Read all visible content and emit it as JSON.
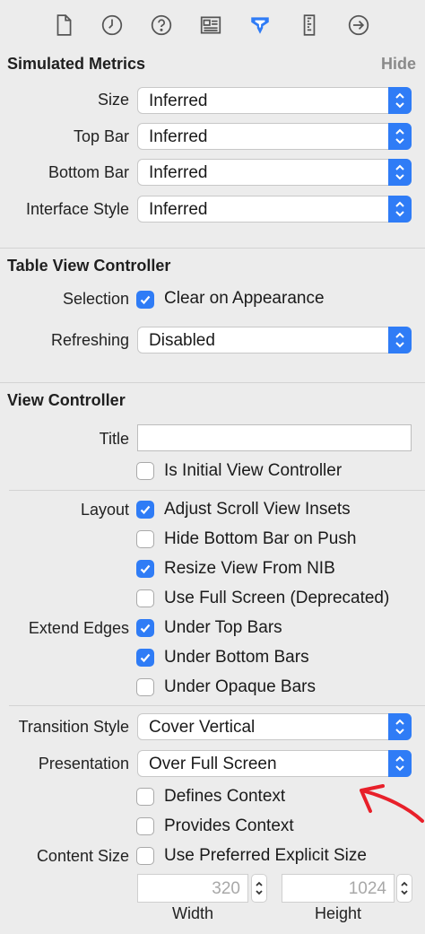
{
  "simulated_metrics": {
    "title": "Simulated Metrics",
    "hide_label": "Hide",
    "rows": [
      {
        "label": "Size",
        "value": "Inferred"
      },
      {
        "label": "Top Bar",
        "value": "Inferred"
      },
      {
        "label": "Bottom Bar",
        "value": "Inferred"
      },
      {
        "label": "Interface Style",
        "value": "Inferred"
      }
    ]
  },
  "table_view_controller": {
    "title": "Table View Controller",
    "selection_label": "Selection",
    "clear_on_appearance": {
      "label": "Clear on Appearance",
      "checked": true
    },
    "refreshing_label": "Refreshing",
    "refreshing_value": "Disabled"
  },
  "view_controller": {
    "title": "View Controller",
    "title_field_label": "Title",
    "title_field_value": "",
    "is_initial": {
      "label": "Is Initial View Controller",
      "checked": false
    },
    "layout_label": "Layout",
    "layout_options": [
      {
        "label": "Adjust Scroll View Insets",
        "checked": true
      },
      {
        "label": "Hide Bottom Bar on Push",
        "checked": false
      },
      {
        "label": "Resize View From NIB",
        "checked": true
      },
      {
        "label": "Use Full Screen (Deprecated)",
        "checked": false
      }
    ],
    "extend_edges_label": "Extend Edges",
    "extend_edges_options": [
      {
        "label": "Under Top Bars",
        "checked": true
      },
      {
        "label": "Under Bottom Bars",
        "checked": true
      },
      {
        "label": "Under Opaque Bars",
        "checked": false
      }
    ],
    "transition_style_label": "Transition Style",
    "transition_style_value": "Cover Vertical",
    "presentation_label": "Presentation",
    "presentation_value": "Over Full Screen",
    "defines_context": {
      "label": "Defines Context",
      "checked": false
    },
    "provides_context": {
      "label": "Provides Context",
      "checked": false
    },
    "content_size_label": "Content Size",
    "use_preferred_size": {
      "label": "Use Preferred Explicit Size",
      "checked": false
    },
    "width_value": "320",
    "width_label": "Width",
    "height_value": "1024",
    "height_label": "Height"
  },
  "colors": {
    "accent": "#2f7cf6",
    "annotation_arrow": "#e8202a",
    "panel_bg": "#ececec"
  }
}
